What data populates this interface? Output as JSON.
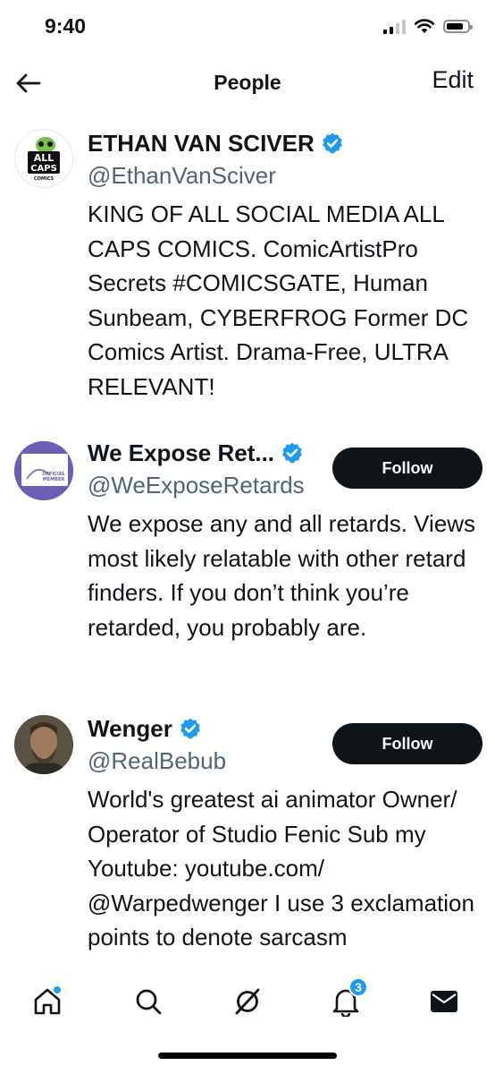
{
  "status": {
    "time": "9:40"
  },
  "header": {
    "title": "People",
    "edit_label": "Edit"
  },
  "users": [
    {
      "name": "ETHAN VAN SCIVER",
      "handle": "@EthanVanSciver",
      "verified": true,
      "avatar_text": [
        "ALL",
        "CAPS",
        "COMICS"
      ],
      "bio": "KING OF ALL SOCIAL MEDIA ALL CAPS COMICS. ComicArtistPro Secrets #COMICSGATE, Human Sunbeam, CYBERFROG Former DC Comics Artist. Drama-Free, ULTRA RELEVANT!"
    },
    {
      "name": "We Expose Ret...",
      "handle": "@WeExposeRetards",
      "verified": true,
      "follow_label": "Follow",
      "avatar_text": [
        "OFFICIAL",
        "MEMBER"
      ],
      "bio": "We expose any and all retards. Views most likely relatable with other retard finders. If you don’t think you’re retarded, you probably are."
    },
    {
      "name": "Wenger",
      "handle": "@RealBebub",
      "verified": true,
      "follow_label": "Follow",
      "bio": "World's greatest ai animator Owner/ Operator of Studio Fenic Sub my Youtube: youtube.com/ @Warpedwenger I use 3 exclamation points to denote sarcasm"
    }
  ],
  "nav": {
    "notifications_badge": "3"
  },
  "colors": {
    "accent": "#1d9bf0",
    "text": "#0f1419",
    "secondary": "#536471",
    "button": "#0f1419"
  },
  "icons": [
    "back-arrow-icon",
    "verified-badge-icon",
    "home-icon",
    "search-icon",
    "grok-icon",
    "bell-icon",
    "mail-icon"
  ]
}
